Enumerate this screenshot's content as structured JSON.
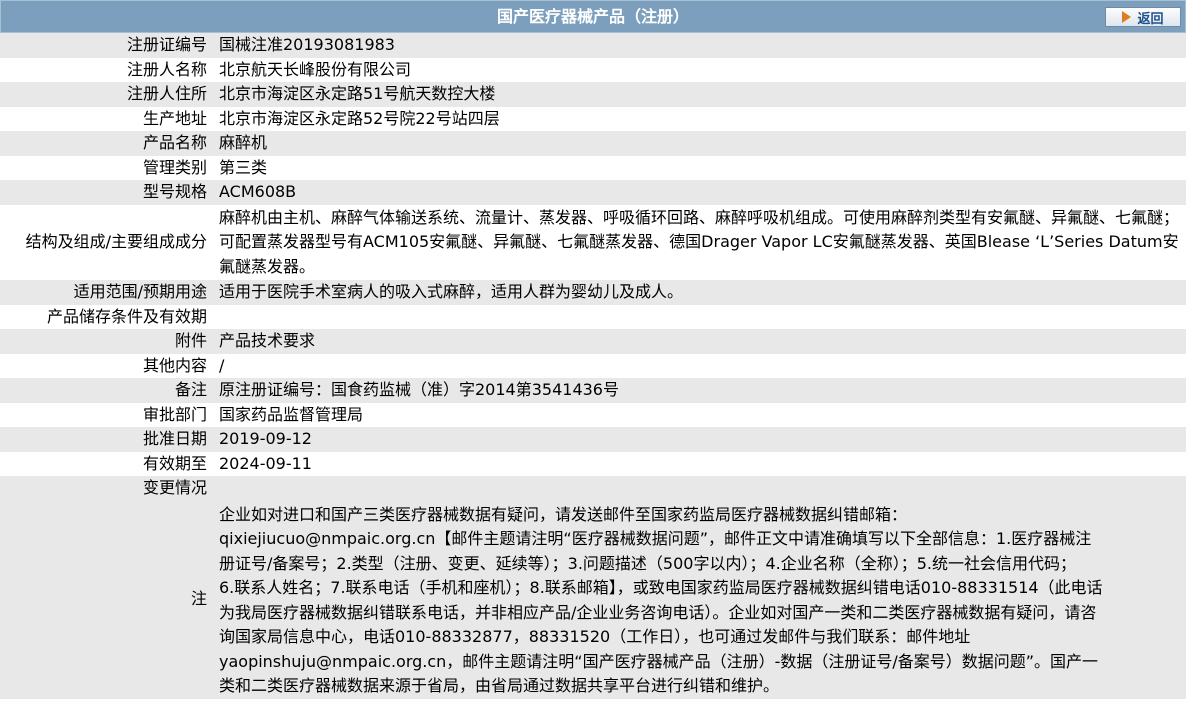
{
  "header": {
    "title": "国产医疗器械产品（注册）",
    "back_label": "返回"
  },
  "rows": [
    {
      "label": "注册证编号",
      "value": "国械注准20193081983"
    },
    {
      "label": "注册人名称",
      "value": "北京航天长峰股份有限公司"
    },
    {
      "label": "注册人住所",
      "value": "北京市海淀区永定路51号航天数控大楼"
    },
    {
      "label": "生产地址",
      "value": "北京市海淀区永定路52号院22号站四层"
    },
    {
      "label": "产品名称",
      "value": "麻醉机"
    },
    {
      "label": "管理类别",
      "value": "第三类"
    },
    {
      "label": "型号规格",
      "value": "ACM608B"
    },
    {
      "label": "结构及组成/主要组成成分",
      "value": "麻醉机由主机、麻醉气体输送系统、流量计、蒸发器、呼吸循环回路、麻醉呼吸机组成。可使用麻醉剂类型有安氟醚、异氟醚、七氟醚；可配置蒸发器型号有ACM105安氟醚、异氟醚、七氟醚蒸发器、德国Drager Vapor LC安氟醚蒸发器、英国Blease ‘L’Series Datum安氟醚蒸发器。"
    },
    {
      "label": "适用范围/预期用途",
      "value": "适用于医院手术室病人的吸入式麻醉，适用人群为婴幼儿及成人。"
    },
    {
      "label": "产品储存条件及有效期",
      "value": ""
    },
    {
      "label": "附件",
      "value": "产品技术要求"
    },
    {
      "label": "其他内容",
      "value": "/"
    },
    {
      "label": "备注",
      "value": "原注册证编号：国食药监械（准）字2014第3541436号"
    },
    {
      "label": "审批部门",
      "value": "国家药品监督管理局"
    },
    {
      "label": "批准日期",
      "value": "2019-09-12"
    },
    {
      "label": "有效期至",
      "value": "2024-09-11"
    },
    {
      "label": "变更情况",
      "value": ""
    }
  ],
  "note": {
    "label": "注",
    "lines": [
      "企业如对进口和国产三类医疗器械数据有疑问，请发送邮件至国家药监局医疗器械数据纠错邮箱：",
      "qixiejiucuo@nmpaic.org.cn【邮件主题请注明“医疗器械数据问题”，邮件正文中请准确填写以下全部信息：1.医疗器械注",
      "册证号/备案号；2.类型（注册、变更、延续等）；3.问题描述（500字以内）；4.企业名称（全称）；5.统一社会信用代码；",
      "6.联系人姓名；7.联系电话（手机和座机）；8.联系邮箱】，或致电国家药监局医疗器械数据纠错电话010-88331514（此电话",
      "为我局医疗器械数据纠错联系电话，并非相应产品/企业业务咨询电话）。企业如对国产一类和二类医疗器械数据有疑问，请咨",
      "询国家局信息中心，电话010-88332877，88331520（工作日），也可通过发邮件与我们联系：邮件地址",
      "yaopinshuju@nmpaic.org.cn，邮件主题请注明“国产医疗器械产品（注册）-数据（注册证号/备案号）数据问题”。国产一",
      "类和二类医疗器械数据来源于省局，由省局通过数据共享平台进行纠错和维护。"
    ]
  },
  "colors": {
    "header_bg": "#7c9fbd",
    "row_odd": "#e8e8e8",
    "row_even": "#ffffff",
    "back_arrow": "#e07c1c"
  }
}
